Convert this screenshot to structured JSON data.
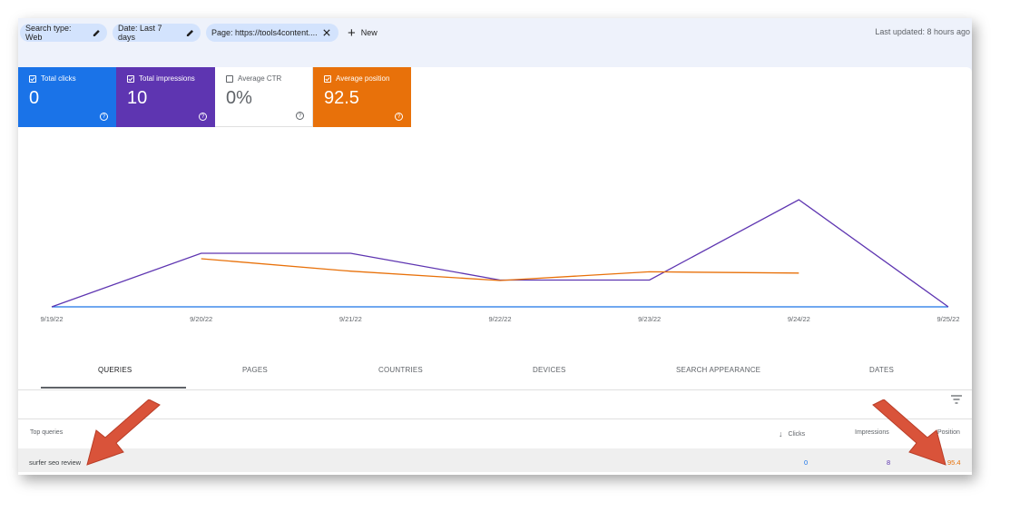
{
  "filters": {
    "chips": [
      "Search type: Web",
      "Date: Last 7 days",
      "Page: https://tools4content...."
    ],
    "new_label": "New",
    "last_updated": "Last updated: 8 hours ago"
  },
  "metrics": [
    {
      "label": "Total clicks",
      "value": "0",
      "checked": true,
      "color": "#1a73e8"
    },
    {
      "label": "Total impressions",
      "value": "10",
      "checked": true,
      "color": "#5e35b1"
    },
    {
      "label": "Average CTR",
      "value": "0%",
      "checked": false,
      "color": "#ffffff"
    },
    {
      "label": "Average position",
      "value": "92.5",
      "checked": true,
      "color": "#e8710a"
    }
  ],
  "chart_data": {
    "type": "line",
    "categories": [
      "9/19/22",
      "9/20/22",
      "9/21/22",
      "9/22/22",
      "9/23/22",
      "9/24/22",
      "9/25/22"
    ],
    "series": [
      {
        "values": [
          0,
          0,
          0,
          0,
          0,
          0,
          0
        ],
        "color": "#1a73e8"
      },
      {
        "values": [
          0,
          2,
          2,
          1,
          1,
          4,
          0
        ],
        "color": "#5e35b1"
      },
      {
        "values": [
          null,
          94.5,
          96.5,
          98,
          96.6,
          96.8,
          null
        ],
        "color": "#e8710a"
      }
    ],
    "grid": false
  },
  "tabs": [
    "QUERIES",
    "PAGES",
    "COUNTRIES",
    "DEVICES",
    "SEARCH APPEARANCE",
    "DATES"
  ],
  "table": {
    "headers": {
      "query": "Top queries",
      "clicks": "Clicks",
      "impressions": "Impressions",
      "position": "Position"
    },
    "rows": [
      {
        "query": "surfer seo review",
        "clicks": "0",
        "impressions": "8",
        "position": "95.4"
      }
    ]
  }
}
